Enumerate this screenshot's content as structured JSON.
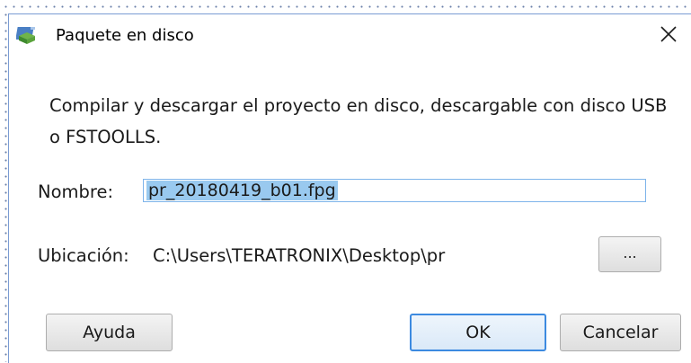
{
  "window": {
    "title": "Paquete en disco",
    "app_icon": "package-disk-icon",
    "close_icon": "close-icon",
    "colors": {
      "border": "#7a9cd3",
      "selection": "#99c9ef",
      "focus": "#3c8ae0"
    }
  },
  "description": "Compilar y descargar el proyecto en disco, descargable con disco USB o FSTOOLLS.",
  "name_field": {
    "label": "Nombre:",
    "value": "pr_20180419_b01.fpg"
  },
  "location": {
    "label": "Ubicación:",
    "value": "C:\\Users\\TERATRONIX\\Desktop\\pr",
    "browse_label": "..."
  },
  "buttons": {
    "help": "Ayuda",
    "ok": "OK",
    "cancel": "Cancelar"
  }
}
